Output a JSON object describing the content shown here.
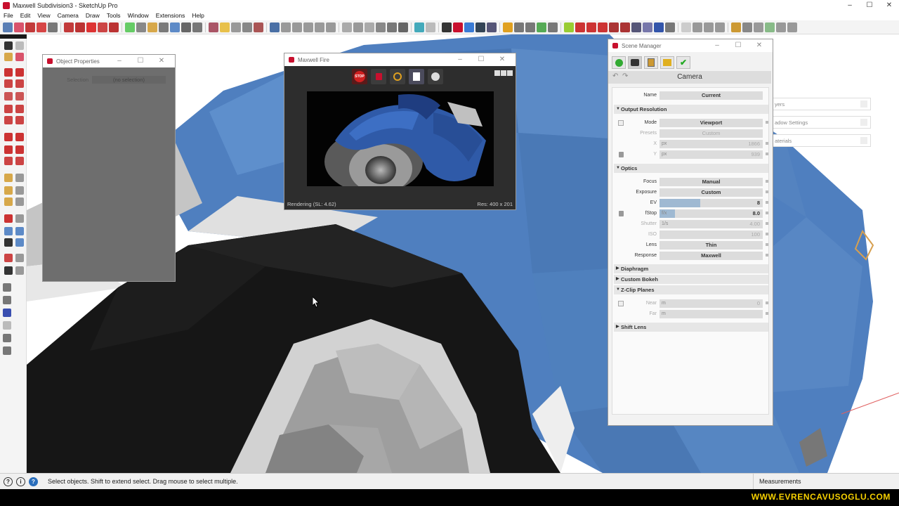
{
  "window": {
    "title": "Maxwell Subdivision3 - SketchUp Pro",
    "controls": [
      "–",
      "☐",
      "✕"
    ]
  },
  "menu": [
    "File",
    "Edit",
    "View",
    "Camera",
    "Draw",
    "Tools",
    "Window",
    "Extensions",
    "Help"
  ],
  "object_properties": {
    "title": "Object Properties",
    "selection_label": "Selection",
    "selection_value": "(no selection)"
  },
  "maxwell_fire": {
    "title": "Maxwell Fire",
    "stop_label": "STOP",
    "status": "Rendering (SL: 4.62)",
    "resolution": "Res: 400 x 201"
  },
  "scene_manager": {
    "title": "Scene Manager",
    "heading": "Camera",
    "name_label": "Name",
    "name_value": "Current",
    "output_resolution": {
      "title": "Output Resolution",
      "mode_label": "Mode",
      "mode_value": "Viewport",
      "presets_label": "Presets",
      "presets_value": "Custom",
      "x_label": "X",
      "x_prefix": "px",
      "x_value": "1866",
      "y_label": "Y",
      "y_prefix": "px",
      "y_value": "939"
    },
    "optics": {
      "title": "Optics",
      "focus_label": "Focus",
      "focus_value": "Manual",
      "exposure_label": "Exposure",
      "exposure_value": "Custom",
      "ev_label": "EV",
      "ev_value": "8",
      "fstop_label": "fStop",
      "fstop_prefix": "f/x",
      "fstop_value": "8.0",
      "shutter_label": "Shutter",
      "shutter_prefix": "1/s",
      "shutter_value": "4.00",
      "iso_label": "ISO",
      "iso_value": "100",
      "lens_label": "Lens",
      "lens_value": "Thin",
      "response_label": "Response",
      "response_value": "Maxwell"
    },
    "diaphragm": "Diaphragm",
    "custom_bokeh": "Custom Bokeh",
    "zclip": {
      "title": "Z-Clip Planes",
      "near_label": "Near",
      "near_prefix": "m",
      "near_value": "0",
      "far_label": "Far",
      "far_prefix": "m"
    },
    "shift_lens": "Shift Lens"
  },
  "tray": {
    "layers": "yers",
    "shadow": "adow Settings",
    "materials": "aterials"
  },
  "status": {
    "hint": "Select objects. Shift to extend select. Drag mouse to select multiple.",
    "measurements": "Measurements"
  },
  "footer": {
    "brand": "WWW.EVRENCAVUSOGLU.COM"
  },
  "colors": {
    "car_blue": "#4f7fbf",
    "tire_black": "#141414",
    "accent_red": "#c8102e",
    "brand_yellow": "#f6d000"
  }
}
